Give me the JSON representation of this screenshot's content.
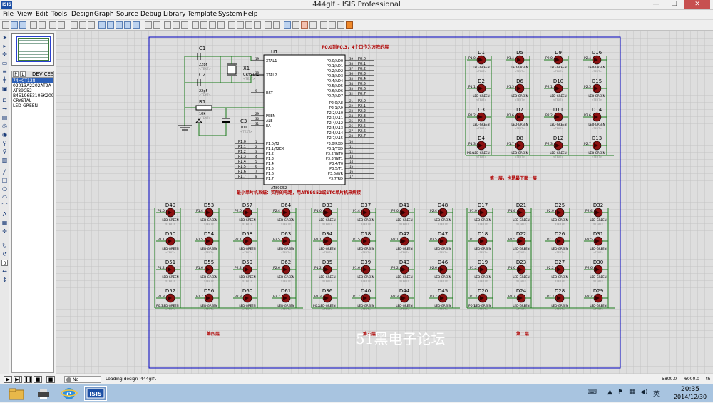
{
  "window": {
    "title": "444glf - ISIS Professional",
    "app_icon": "ISIS",
    "btn_min": "—",
    "btn_max": "❐",
    "btn_close": "✕"
  },
  "menu": [
    "File",
    "View",
    "Edit",
    "Tools",
    "Design",
    "Graph",
    "Source",
    "Debug",
    "Library",
    "Template",
    "System",
    "Help"
  ],
  "device_panel": {
    "pick_p": "P",
    "pick_l": "L",
    "header": "DEVICES",
    "items": [
      "74HCT138",
      "02013A2202AT2A",
      "AT89C52",
      "B45196E3106K209",
      "CRYSTAL",
      "LED-GREEN"
    ],
    "selected_index": 0
  },
  "schematic": {
    "mcu": {
      "ref": "U1",
      "part": "AT89C52",
      "text": "<TEXT>",
      "left_pins": [
        {
          "num": "19",
          "name": "XTAL1"
        },
        {
          "num": "18",
          "name": "XTAL2"
        },
        {
          "num": "9",
          "name": "RST"
        },
        {
          "num": "29",
          "name": "PSEN"
        },
        {
          "num": "30",
          "name": "ALE"
        },
        {
          "num": "31",
          "name": "EA"
        }
      ],
      "p1_pins": [
        {
          "num": "1",
          "name": "P1.0/T2",
          "net": "P1.0"
        },
        {
          "num": "2",
          "name": "P1.1/T2EX",
          "net": "P1.1"
        },
        {
          "num": "3",
          "name": "P1.2",
          "net": "P1.2"
        },
        {
          "num": "4",
          "name": "P1.3",
          "net": "P1.3"
        },
        {
          "num": "5",
          "name": "P1.4",
          "net": "P1.4"
        },
        {
          "num": "6",
          "name": "P1.5",
          "net": "P1.5"
        },
        {
          "num": "7",
          "name": "P1.6",
          "net": "P1.6"
        },
        {
          "num": "8",
          "name": "P1.7",
          "net": "P1.7"
        }
      ],
      "p0_pins": [
        {
          "num": "39",
          "name": "P0.0/AD0",
          "net": "P0.0"
        },
        {
          "num": "38",
          "name": "P0.1/AD1",
          "net": "P0.1"
        },
        {
          "num": "37",
          "name": "P0.2/AD2",
          "net": "P0.2"
        },
        {
          "num": "36",
          "name": "P0.3/AD3",
          "net": "P0.3"
        },
        {
          "num": "35",
          "name": "P0.4/AD4",
          "net": "P0.4"
        },
        {
          "num": "34",
          "name": "P0.5/AD5",
          "net": "P0.5"
        },
        {
          "num": "33",
          "name": "P0.6/AD6",
          "net": "P0.6"
        },
        {
          "num": "32",
          "name": "P0.7/AD7",
          "net": "P0.7"
        }
      ],
      "p2_pins": [
        {
          "num": "21",
          "name": "P2.0/A8",
          "net": "P2.0"
        },
        {
          "num": "22",
          "name": "P2.1/A9",
          "net": "P2.1"
        },
        {
          "num": "23",
          "name": "P2.2/A10",
          "net": "P2.2"
        },
        {
          "num": "24",
          "name": "P2.3/A11",
          "net": "P2.3"
        },
        {
          "num": "25",
          "name": "P2.4/A12",
          "net": "P2.4"
        },
        {
          "num": "26",
          "name": "P2.5/A13",
          "net": "P2.5"
        },
        {
          "num": "27",
          "name": "P2.6/A14",
          "net": "P2.6"
        },
        {
          "num": "28",
          "name": "P2.7/A15",
          "net": "P2.7"
        }
      ],
      "p3_pins": [
        {
          "num": "10",
          "name": "P3.0/RXD"
        },
        {
          "num": "11",
          "name": "P3.1/TXD"
        },
        {
          "num": "12",
          "name": "P3.2/INT0"
        },
        {
          "num": "13",
          "name": "P3.3/INT1"
        },
        {
          "num": "14",
          "name": "P3.4/T0"
        },
        {
          "num": "15",
          "name": "P3.5/T1"
        },
        {
          "num": "16",
          "name": "P3.6/WR"
        },
        {
          "num": "17",
          "name": "P3.7/RD"
        }
      ]
    },
    "components": [
      {
        "ref": "C1",
        "value": "22pF",
        "text": "<TEXT>"
      },
      {
        "ref": "C2",
        "value": "22pF",
        "text": "<TEXT>"
      },
      {
        "ref": "X1",
        "value": "CRYSTAL",
        "text": "<TEXT>"
      },
      {
        "ref": "R1",
        "value": "10k",
        "text": "<TEXT>"
      },
      {
        "ref": "C3",
        "value": "10u",
        "text": "<TEXT>"
      }
    ],
    "notes": {
      "top": "P0.0到P0.3，4个口作为方阵的层",
      "mcu_bottom": "最小单片机系统：实际的电路，用AT89S52或STC单片机来焊接",
      "layer1": "第一层，也是最下面一层",
      "layer2": "第二层",
      "layer3": "第三层",
      "layer4": "第四层",
      "watermark": "51黑电子论坛"
    },
    "led_value": "LED-GREEN",
    "led_text": "<TEXT>",
    "cube_top": {
      "layer_net": "P0.0",
      "columns": [
        {
          "leds": [
            "D1",
            "D2",
            "D3",
            "D4"
          ],
          "nets": [
            "P1.0",
            "P1.1",
            "P1.2",
            "P1.3"
          ]
        },
        {
          "leds": [
            "D5",
            "D6",
            "D7",
            "D8"
          ],
          "nets": [
            "P1.4",
            "P1.5",
            "P1.6",
            "P1.7"
          ]
        },
        {
          "leds": [
            "D9",
            "D10",
            "D11",
            "D12"
          ],
          "nets": [
            "P2.0",
            "P2.1",
            "P2.2",
            "P2.3"
          ]
        },
        {
          "leds": [
            "D16",
            "D15",
            "D14",
            "D13"
          ],
          "nets": [
            "P2.4",
            "P2.5",
            "P2.6",
            "P2.7"
          ]
        }
      ]
    },
    "cube_left": {
      "layer_net": "P0.3",
      "columns": [
        {
          "leds": [
            "D49",
            "D50",
            "D51",
            "D52"
          ],
          "nets": [
            "P1.0",
            "P1.1",
            "P1.2",
            "P1.3"
          ]
        },
        {
          "leds": [
            "D53",
            "D54",
            "D55",
            "D56"
          ],
          "nets": [
            "P1.4",
            "P1.5",
            "P1.6",
            "P1.7"
          ]
        },
        {
          "leds": [
            "D57",
            "D58",
            "D59",
            "D60"
          ],
          "nets": [
            "P2.0",
            "P2.1",
            "P2.2",
            "P2.3"
          ]
        },
        {
          "leds": [
            "D64",
            "D63",
            "D62",
            "D61"
          ],
          "nets": [
            "P2.4",
            "P2.5",
            "P2.6",
            "P2.7"
          ]
        }
      ]
    },
    "cube_mid": {
      "layer_net": "P0.2",
      "columns": [
        {
          "leds": [
            "D33",
            "D34",
            "D35",
            "D36"
          ],
          "nets": [
            "P1.0",
            "P1.1",
            "P1.2",
            "P1.3"
          ]
        },
        {
          "leds": [
            "D37",
            "D38",
            "D39",
            "D40"
          ],
          "nets": [
            "P1.4",
            "P1.5",
            "P1.6",
            "P1.7"
          ]
        },
        {
          "leds": [
            "D41",
            "D42",
            "D43",
            "D44"
          ],
          "nets": [
            "P2.0",
            "P2.1",
            "P2.2",
            "P2.3"
          ]
        },
        {
          "leds": [
            "D48",
            "D47",
            "D46",
            "D45"
          ],
          "nets": [
            "P2.4",
            "P2.5",
            "P2.6",
            "P2.7"
          ]
        }
      ]
    },
    "cube_right": {
      "layer_net": "P0.1",
      "columns": [
        {
          "leds": [
            "D17",
            "D18",
            "D19",
            "D20"
          ],
          "nets": [
            "P1.0",
            "P1.1",
            "P1.2",
            "P1.3"
          ]
        },
        {
          "leds": [
            "D21",
            "D22",
            "D23",
            "D24"
          ],
          "nets": [
            "P1.4",
            "P1.5",
            "P1.6",
            "P1.7"
          ]
        },
        {
          "leds": [
            "D25",
            "D26",
            "D27",
            "D28"
          ],
          "nets": [
            "P2.0",
            "P2.1",
            "P2.2",
            "P2.3"
          ]
        },
        {
          "leds": [
            "D32",
            "D31",
            "D30",
            "D29"
          ],
          "nets": [
            "P2.4",
            "P2.5",
            "P2.6",
            "P2.7"
          ]
        }
      ]
    }
  },
  "status": {
    "messages": "No Messages",
    "text": "Loading design '444glf'.",
    "coord_x": "-5800.0",
    "coord_y": "6000.0",
    "unit": "th"
  },
  "taskbar": {
    "time": "20:35",
    "date": "2014/12/30",
    "ime": "英",
    "isis": "ISIS"
  },
  "colors": {
    "wire": "#1a7a1a",
    "led": "#8b1010",
    "text_blue": "#1030b0",
    "note_red": "#b00000",
    "sheet_border": "#0000c0",
    "accent": "#2b5fb8"
  }
}
